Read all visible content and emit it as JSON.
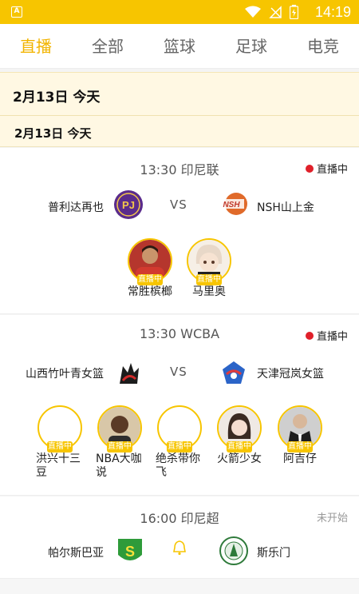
{
  "status_bar": {
    "time": "14:19",
    "app_badge": "A"
  },
  "tabs": [
    {
      "label": "直播",
      "active": true
    },
    {
      "label": "全部",
      "active": false
    },
    {
      "label": "篮球",
      "active": false
    },
    {
      "label": "足球",
      "active": false
    },
    {
      "label": "电竞",
      "active": false
    }
  ],
  "date_header": "2月13日  今天",
  "date_subheader": "2月13日   今天",
  "matches": [
    {
      "time_league": "13:30  印尼联",
      "status": "直播中",
      "home": "普利达再也",
      "vs": "VS",
      "away": "NSH山上金",
      "anchors": [
        {
          "name": "常胜槟榔",
          "tag": "直播中"
        },
        {
          "name": "马里奥",
          "tag": "直播中"
        }
      ]
    },
    {
      "time_league": "13:30  WCBA",
      "status": "直播中",
      "home": "山西竹叶青女篮",
      "vs": "VS",
      "away": "天津冠岚女篮",
      "anchors": [
        {
          "name": "洪兴十三\n豆",
          "tag": "直播中"
        },
        {
          "name": "NBA大咖\n说",
          "tag": "直播中"
        },
        {
          "name": "绝杀带你\n飞",
          "tag": "直播中"
        },
        {
          "name": "火箭少女",
          "tag": "直播中"
        },
        {
          "name": "阿吉仔",
          "tag": "直播中"
        }
      ]
    },
    {
      "time_league": "16:00  印尼超",
      "status": "未开始",
      "home": "帕尔斯巴亚",
      "away": "斯乐门"
    }
  ],
  "colors": {
    "accent": "#f7c500",
    "live_dot": "#e0202a"
  }
}
